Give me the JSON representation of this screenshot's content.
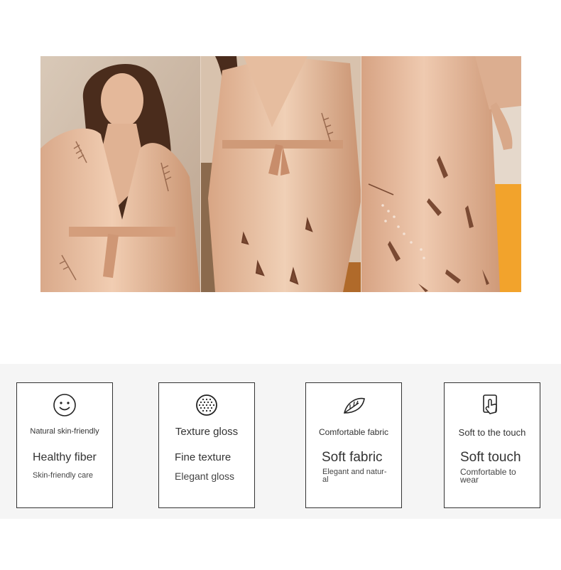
{
  "features": [
    {
      "icon": "smiley-face-icon",
      "small": "Natural skin-friendly",
      "big": "Healthy fiber",
      "desc": "Skin-friendly care"
    },
    {
      "icon": "dotted-circle-icon",
      "small": "Texture gloss",
      "big": "Fine texture",
      "desc": "Elegant gloss"
    },
    {
      "icon": "leaf-icon",
      "small": "Comfortable fabric",
      "big": "Soft fabric",
      "desc": "Elegant and natur-\nal"
    },
    {
      "icon": "touch-hand-icon",
      "small": "Soft to the touch",
      "big": "Soft touch",
      "desc": "Comfortable to\nwear"
    }
  ]
}
